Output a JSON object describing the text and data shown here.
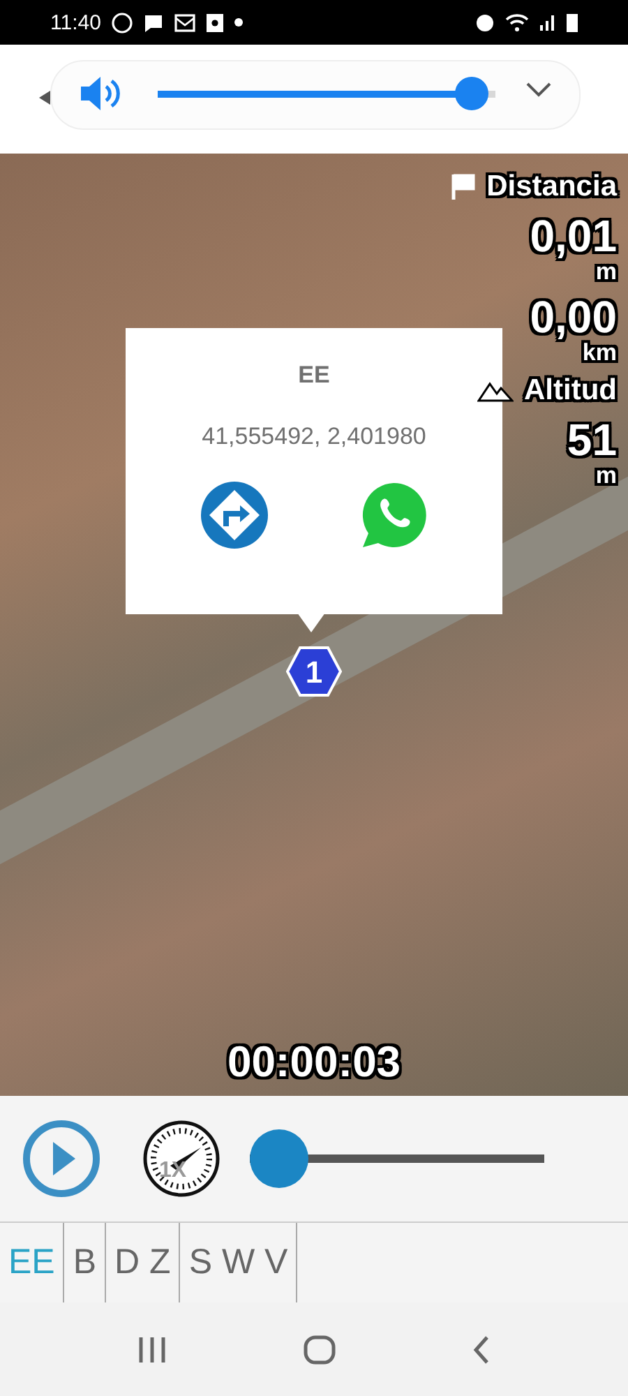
{
  "status_bar": {
    "time": "11:40"
  },
  "header": {
    "volume": {
      "level": 0.93
    }
  },
  "distance": {
    "label": "Distancia",
    "values": [
      {
        "value": "0,01",
        "unit": "m"
      },
      {
        "value": "0,00",
        "unit": "km"
      }
    ]
  },
  "altitude": {
    "label": "Altitud",
    "values": [
      {
        "value": "51",
        "unit": "m"
      }
    ]
  },
  "popup": {
    "title": "EE",
    "coordinates": "41,555492, 2,401980"
  },
  "marker": {
    "label": "1"
  },
  "elapsed": "00:00:03",
  "playback": {
    "playing": false,
    "speed": "1X",
    "progress": {
      "level": 0
    }
  },
  "tabs": [
    {
      "label": "EE",
      "selected": true
    },
    {
      "label": "B",
      "selected": false
    },
    {
      "label": "D Z",
      "selected": false
    },
    {
      "label": "S W V",
      "selected": false
    }
  ]
}
